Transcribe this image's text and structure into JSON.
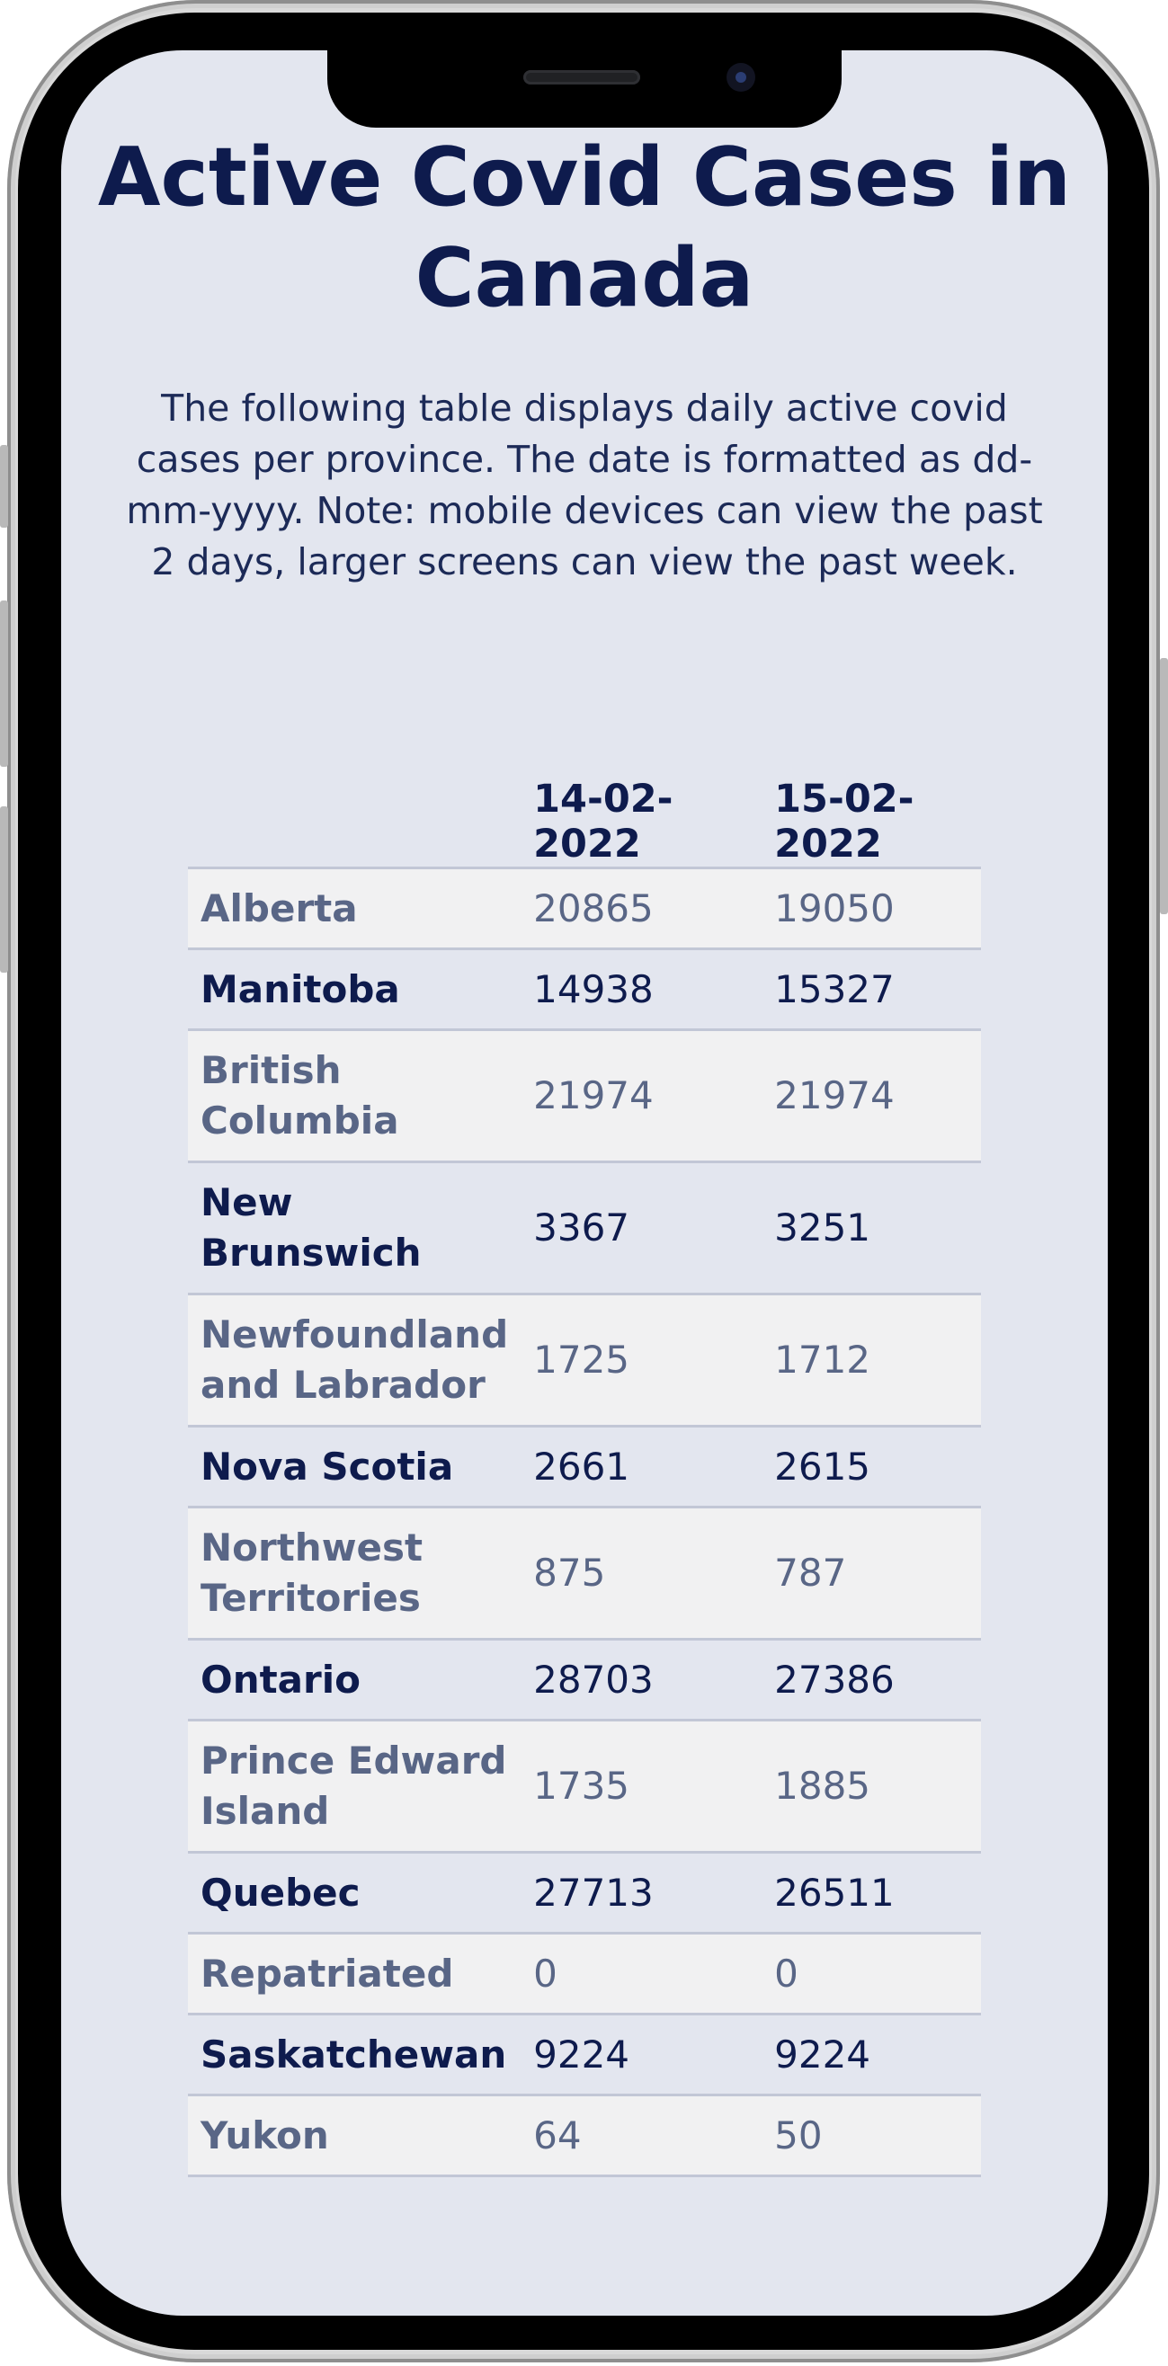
{
  "page": {
    "title": "Active Covid Cases in Canada",
    "intro": "The following table displays daily active covid cases per province. The date is formatted as dd-mm-yyyy. Note: mobile devices can view the past 2 days, larger screens can view the past week."
  },
  "table": {
    "headers": [
      "",
      "14-02-2022",
      "15-02-2022"
    ],
    "rows": [
      {
        "province": "Alberta",
        "values": [
          "20865",
          "19050"
        ]
      },
      {
        "province": "Manitoba",
        "values": [
          "14938",
          "15327"
        ]
      },
      {
        "province": "British Columbia",
        "values": [
          "21974",
          "21974"
        ]
      },
      {
        "province": "New Brunswich",
        "values": [
          "3367",
          "3251"
        ]
      },
      {
        "province": "Newfoundland and Labrador",
        "values": [
          "1725",
          "1712"
        ]
      },
      {
        "province": "Nova Scotia",
        "values": [
          "2661",
          "2615"
        ]
      },
      {
        "province": "Northwest Territories",
        "values": [
          "875",
          "787"
        ]
      },
      {
        "province": "Ontario",
        "values": [
          "28703",
          "27386"
        ]
      },
      {
        "province": "Prince Edward Island",
        "values": [
          "1735",
          "1885"
        ]
      },
      {
        "province": "Quebec",
        "values": [
          "27713",
          "26511"
        ]
      },
      {
        "province": "Repatriated",
        "values": [
          "0",
          "0"
        ]
      },
      {
        "province": "Saskatchewan",
        "values": [
          "9224",
          "9224"
        ]
      },
      {
        "province": "Yukon",
        "values": [
          "64",
          "50"
        ]
      }
    ]
  },
  "colors": {
    "background": "#e3e6ef",
    "heading": "#0e1b4d",
    "muted_text": "#596686",
    "striped_row": "#f1f1f2",
    "row_border": "#c2c7d6"
  }
}
